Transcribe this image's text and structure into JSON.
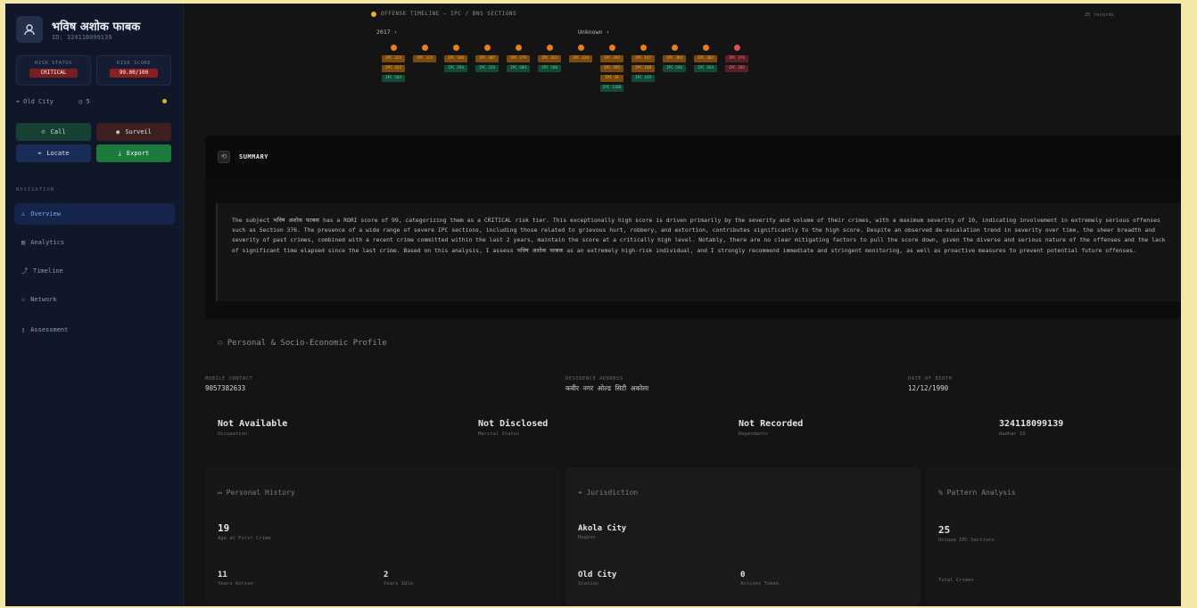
{
  "profile": {
    "name": "भविष अशोक फाबक",
    "sub": "ID: 324118099139",
    "risk_label": "RISK STATUS",
    "risk_value": "CRITICAL",
    "score_label": "RISK SCORE",
    "score_value": "99.00/100",
    "station": "Old City",
    "count": "5"
  },
  "actions": {
    "call": "Call",
    "surveil": "Surveil",
    "locate": "Locate",
    "export": "Export"
  },
  "nav": {
    "heading": "NAVIGATION",
    "items": [
      "Overview",
      "Analytics",
      "Timeline",
      "Network",
      "Assessment"
    ]
  },
  "timeline": {
    "header": "OFFENSE TIMELINE — IPC / BNS SECTIONS",
    "count": "25 records",
    "year_label": "2017",
    "unknown_label": "Unknown",
    "columns": [
      [
        "IPC 324",
        "IPC 323",
        "IPC 504"
      ],
      [
        "IPC 324"
      ],
      [
        "IPC 506",
        "IPC 294"
      ],
      [
        "IPC 307",
        "IPC 326"
      ],
      [
        "IPC 379",
        "IPC 504"
      ],
      [
        "IPC 323",
        "IPC 506"
      ],
      [
        "IPC 324"
      ],
      [
        "IPC 392",
        "IPC 395",
        "IPC 34",
        "IPC 120B"
      ],
      [
        "IPC 147",
        "IPC 148",
        "IPC 149"
      ],
      [
        "IPC 384",
        "IPC 506"
      ],
      [
        "IPC 302",
        "IPC 364"
      ],
      [
        "IPC 376",
        "IPC 201"
      ]
    ]
  },
  "summary": {
    "title": "SUMMARY",
    "text": "The subject भविष अशोक फाबक has a RORI score of 99, categorizing them as a CRITICAL risk tier. This exceptionally high score is driven primarily by the severity and volume of their crimes, with a maximum severity of 10, indicating involvement in extremely serious offenses such as Section 376. The presence of a wide range of severe IPC sections, including those related to grievous hurt, robbery, and extortion, contributes significantly to the high score. Despite an observed de-escalation trend in severity over time, the sheer breadth and severity of past crimes, combined with a recent crime committed within the last 2 years, maintain the score at a critically high level. Notably, there are no clear mitigating factors to pull the score down, given the diverse and serious nature of the offenses and the lack of significant time elapsed since the last crime. Based on this analysis, I assess भविष अशोक फाबक as an extremely high-risk individual, and I strongly recommend immediate and stringent monitoring, as well as proactive measures to prevent potential future offenses."
  },
  "personal": {
    "title": "Personal & Socio-Economic Profile",
    "mobile_label": "MOBILE CONTACT",
    "mobile": "9057382633",
    "address_label": "RESIDENCE ADDRESS",
    "address": "कबीर नगर ओल्ड सिटी अकोला",
    "dob_label": "DATE OF BIRTH",
    "dob": "12/12/1990",
    "occupation": "Not Available",
    "occupation_label": "Occupation",
    "marital": "Not Disclosed",
    "marital_label": "Marital Status",
    "dependents": "Not Recorded",
    "dependents_label": "Dependents",
    "aadhar": "324118099139",
    "aadhar_label": "Aadhar ID"
  },
  "panels": {
    "history_title": "Personal History",
    "first_age": "19",
    "first_age_label": "Age at First Crime",
    "years_active": "11",
    "years_active_label": "Years Active",
    "years_idle": "2",
    "years_idle_label": "Years Idle",
    "juris_title": "Jurisdiction",
    "region": "Akola City",
    "region_label": "Region",
    "station": "Old City",
    "station_label": "Station",
    "actions_taken": "0",
    "actions_taken_label": "Actions Taken",
    "pattern_title": "Pattern Analysis",
    "unique_ipc": "25",
    "unique_ipc_label": "Unique IPC Sections",
    "total_crimes_label": "Total Crimes"
  }
}
